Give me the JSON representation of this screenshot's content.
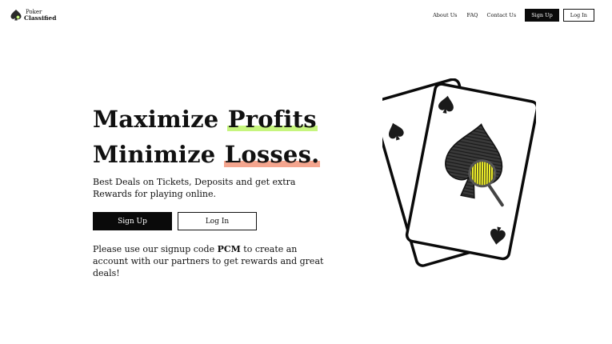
{
  "header": {
    "logo_line1": "Poker",
    "logo_line2": "Classified",
    "nav": {
      "about": "About Us",
      "faq": "FAQ",
      "contact": "Contact Us",
      "signup": "Sign Up",
      "login": "Log In"
    }
  },
  "hero": {
    "title_line1_plain": "Maximize ",
    "title_line1_highlight": "Profits",
    "title_line2_plain": "Minimize ",
    "title_line2_highlight": "Losses.",
    "subtitle": "Best Deals on Tickets, Deposits and get extra Rewards for playing online.",
    "signup_button": "Sign Up",
    "login_button": "Log In",
    "note_before": "Please use our signup code ",
    "note_code": "PCM",
    "note_after": " to create an account with our partners to get rewards and great deals!"
  },
  "colors": {
    "highlight_green": "#c6f57e",
    "highlight_red": "#f4a58e",
    "magnifier_yellow": "#f2f22a",
    "primary_dark": "#0a0a0a"
  },
  "illustration": {
    "icon": "playing-cards-spade-magnifier-icon"
  }
}
